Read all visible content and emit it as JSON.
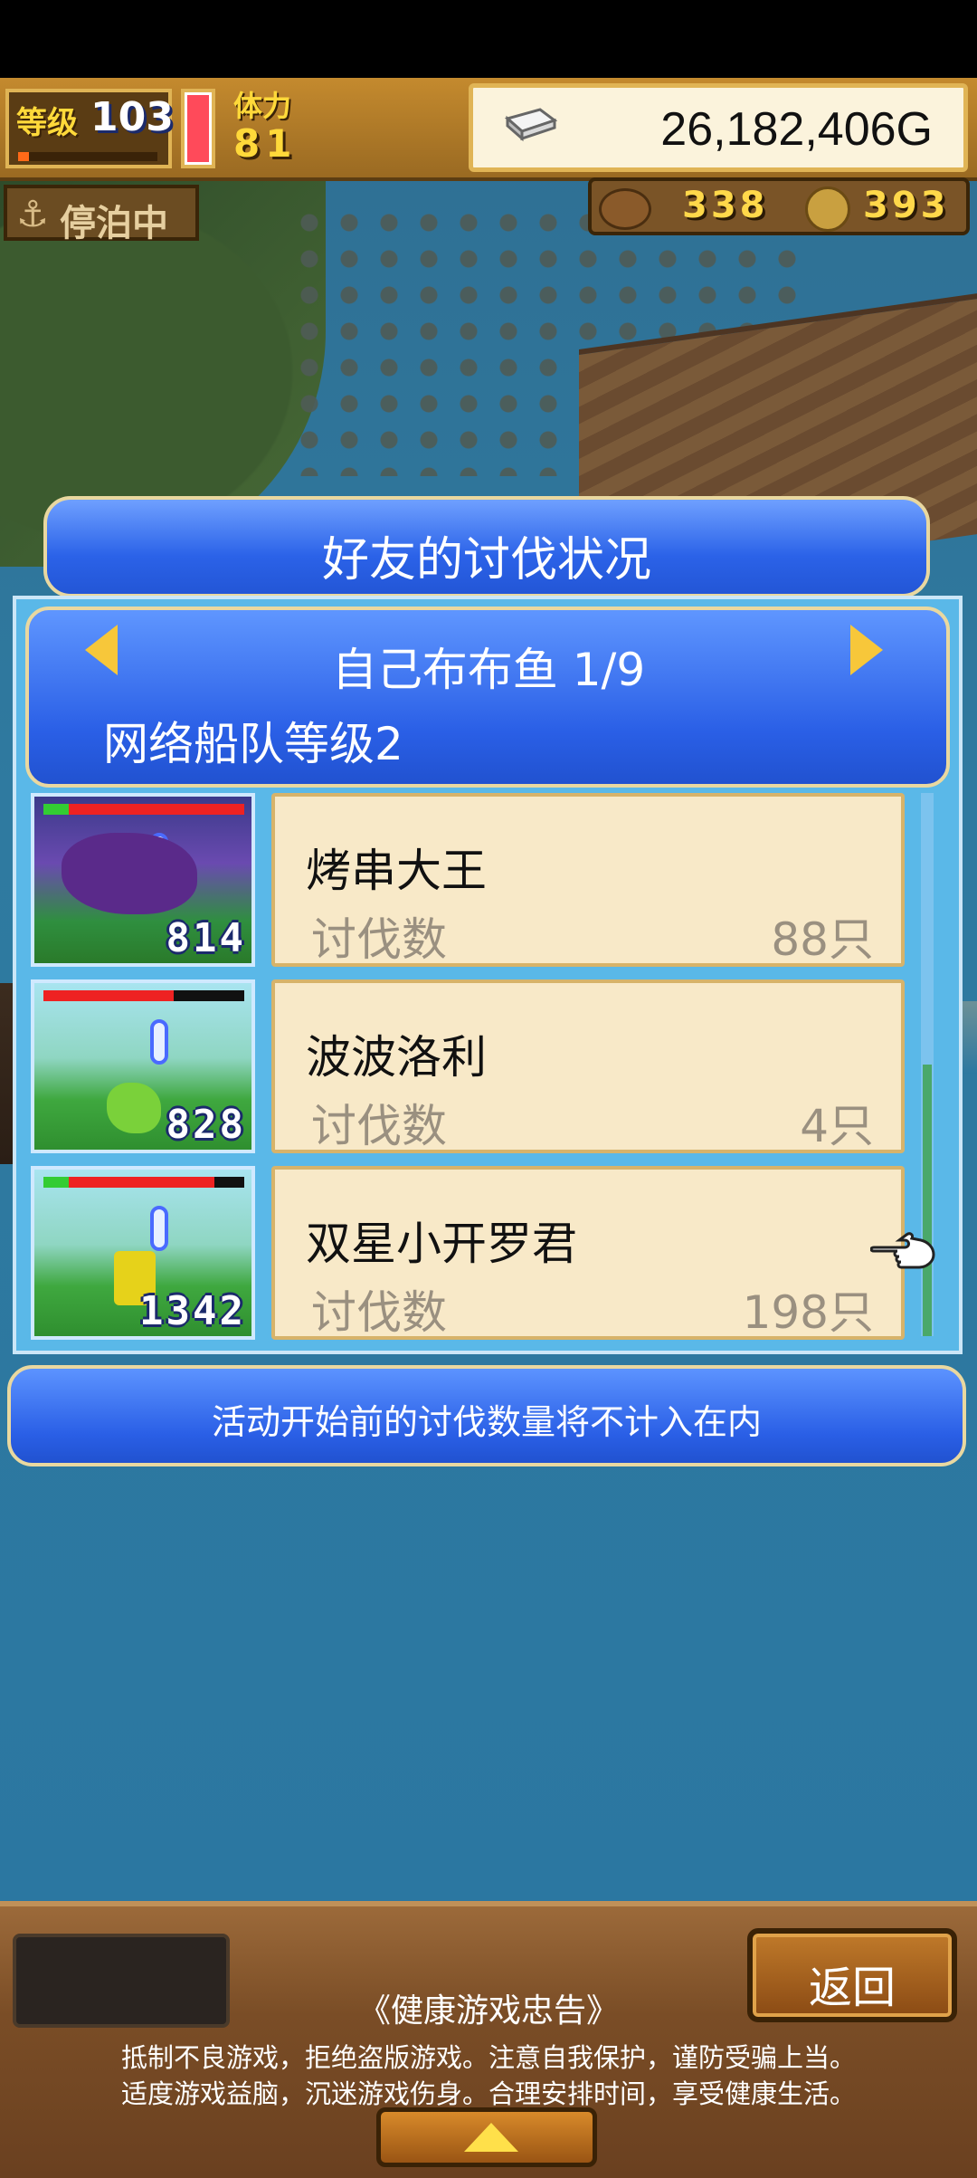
{
  "hud": {
    "level_label": "等级",
    "level_value": "103",
    "level_progress": 0.08,
    "stamina_label": "体力",
    "stamina_value": "81",
    "gold_value": "26,182,406G",
    "status_label": "停泊中",
    "resource1_value": "338",
    "resource2_value": "393"
  },
  "dialog": {
    "title": "好友的讨伐状况",
    "friend_name": "自己布布鱼 1/9",
    "fleet_level": "网络船队等级2",
    "entries": [
      {
        "name": "烤串大王",
        "count_label": "讨伐数",
        "count": "88只",
        "level_badge": "814",
        "hp_fraction": 1.0
      },
      {
        "name": "波波洛利",
        "count_label": "讨伐数",
        "count": "4只",
        "level_badge": "828",
        "hp_fraction": 0.65
      },
      {
        "name": "双星小开罗君",
        "count_label": "讨伐数",
        "count": "198只",
        "level_badge": "1342",
        "hp_fraction": 0.85
      }
    ],
    "notice": "活动开始前的讨伐数量将不计入在内"
  },
  "bottom": {
    "back_label": "返回",
    "advice_title": "《健康游戏忠告》",
    "advice_line1": "抵制不良游戏，拒绝盗版游戏。注意自我保护，谨防受骗上当。",
    "advice_line2": "适度游戏益脑，沉迷游戏伤身。合理安排时间，享受健康生活。"
  },
  "icons": {
    "anchor": "anchor-icon",
    "silver": "silver-bar-icon",
    "left_arrow": "arrow-left-icon",
    "right_arrow": "arrow-right-icon",
    "hand": "pointing-hand-icon",
    "up": "arrow-up-icon"
  }
}
